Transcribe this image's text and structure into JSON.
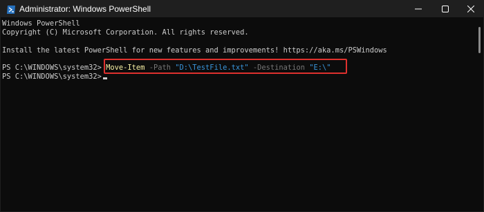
{
  "window": {
    "title": "Administrator: Windows PowerShell",
    "icon": "powershell-icon",
    "controls": [
      "minimize-icon",
      "maximize-icon",
      "close-icon"
    ]
  },
  "console": {
    "line1": "Windows PowerShell",
    "line2": "Copyright (C) Microsoft Corporation. All rights reserved.",
    "line3": "Install the latest PowerShell for new features and improvements! https://aka.ms/PSWindows",
    "prompt": "PS C:\\WINDOWS\\system32> ",
    "command": {
      "cmdlet": "Move-Item",
      "param1": "-Path",
      "value1": "\"D:\\TestFile.txt\"",
      "param2": "-Destination",
      "value2": "\"E:\\\""
    },
    "prompt2": "PS C:\\WINDOWS\\system32>"
  },
  "colors": {
    "background": "#0c0c0c",
    "text": "#cccccc",
    "cmdlet": "#f9f1a5",
    "parameter": "#767676",
    "string": "#3a96dd",
    "highlight_box": "#e0312e"
  }
}
